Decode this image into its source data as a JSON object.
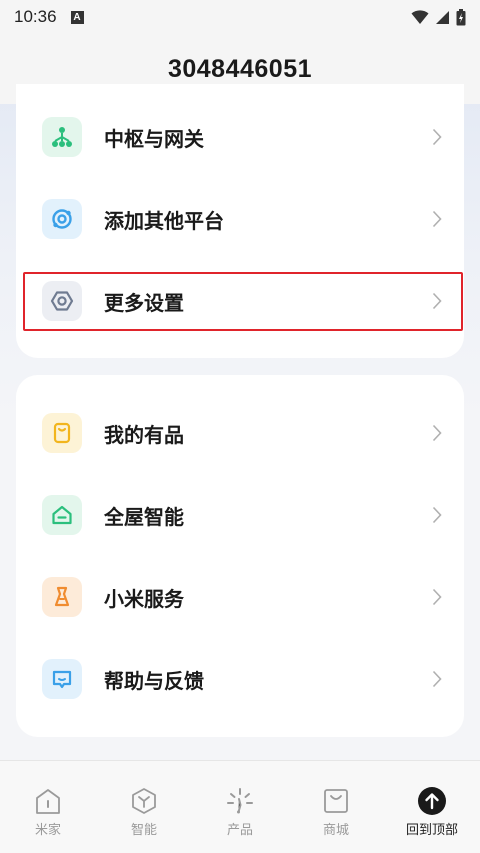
{
  "status_bar": {
    "time": "10:36",
    "badge": "A"
  },
  "header": {
    "title": "3048446051"
  },
  "top_card": {
    "items": [
      {
        "label": "中枢与网关",
        "icon": "hub-gateway-icon"
      },
      {
        "label": "添加其他平台",
        "icon": "add-platform-icon"
      },
      {
        "label": "更多设置",
        "icon": "settings-hexagon-icon"
      }
    ]
  },
  "bottom_card": {
    "items": [
      {
        "label": "我的有品",
        "icon": "youpin-bag-icon"
      },
      {
        "label": "全屋智能",
        "icon": "smart-home-icon"
      },
      {
        "label": "小米服务",
        "icon": "service-icon"
      },
      {
        "label": "帮助与反馈",
        "icon": "feedback-icon"
      }
    ]
  },
  "bottom_nav": {
    "items": [
      {
        "label": "米家",
        "icon": "home-icon"
      },
      {
        "label": "智能",
        "icon": "smart-cube-icon"
      },
      {
        "label": "产品",
        "icon": "products-sparkle-icon"
      },
      {
        "label": "商城",
        "icon": "shop-bag-icon"
      },
      {
        "label": "回到顶部",
        "icon": "back-to-top-icon"
      }
    ]
  },
  "colors": {
    "highlight": "#e0242b",
    "hub_green": "#2bbf7d",
    "platform_blue": "#3aa0e8",
    "settings_gray": "#6f7b91",
    "youpin_yellow": "#f2b51d",
    "smart_green": "#2bbf7d",
    "service_orange": "#f08c30",
    "feedback_blue": "#3aa0e8"
  }
}
